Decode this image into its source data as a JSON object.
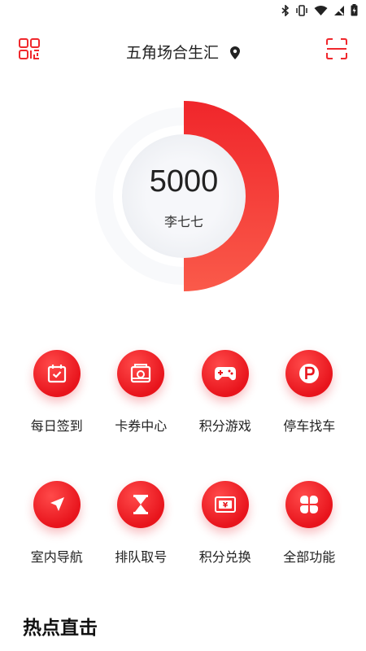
{
  "header": {
    "location": "五角场合生汇",
    "left_icon": "qr-code-icon",
    "right_icon": "scan-icon",
    "accent_color": "#f0282d"
  },
  "status_bar": {
    "icons": [
      "bluetooth-icon",
      "vibrate-icon",
      "wifi-icon",
      "no-signal-icon",
      "battery-charging-icon"
    ]
  },
  "summary": {
    "points": "5000",
    "name": "李七七",
    "progress_fraction": 0.5
  },
  "features": [
    {
      "label": "每日签到",
      "icon": "daily-checkin-icon"
    },
    {
      "label": "卡券中心",
      "icon": "coupon-center-icon"
    },
    {
      "label": "积分游戏",
      "icon": "gamepad-icon"
    },
    {
      "label": "停车找车",
      "icon": "parking-icon"
    },
    {
      "label": "室内导航",
      "icon": "navigation-icon"
    },
    {
      "label": "排队取号",
      "icon": "hourglass-icon"
    },
    {
      "label": "积分兑换",
      "icon": "points-exchange-icon"
    },
    {
      "label": "全部功能",
      "icon": "all-functions-icon"
    }
  ],
  "hot_section": {
    "title": "热点直击"
  }
}
